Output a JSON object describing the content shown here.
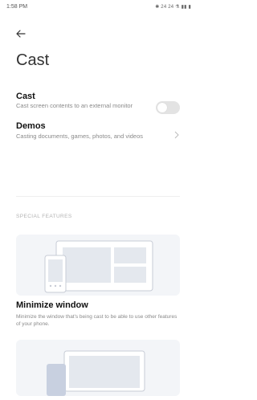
{
  "status_bar": {
    "time": "1:58 PM",
    "icons_text": "✱ 24 24 ⚗ ▮▮ ▮"
  },
  "header": {
    "back_icon": "arrow-left-icon",
    "title": "Cast"
  },
  "settings": {
    "cast": {
      "title": "Cast",
      "description": "Cast screen contents to an external monitor",
      "toggle_state": "off"
    },
    "demos": {
      "title": "Demos",
      "description": "Casting documents, games, photos, and videos",
      "icon": "chevron-right-icon"
    }
  },
  "special_features": {
    "header": "SPECIAL FEATURES",
    "features": [
      {
        "title": "Minimize window",
        "description": "Minimize the window that's being cast to be able to use other features of your phone."
      }
    ]
  },
  "colors": {
    "background": "#ffffff",
    "illustration_bg": "#f3f5f8",
    "illustration_stroke": "#c7ccd6",
    "toggle_off": "#e3e3e3"
  }
}
